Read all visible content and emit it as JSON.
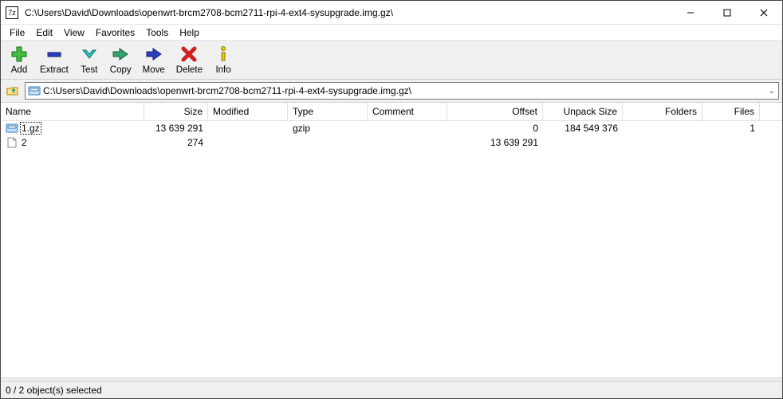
{
  "window": {
    "title": "C:\\Users\\David\\Downloads\\openwrt-brcm2708-bcm2711-rpi-4-ext4-sysupgrade.img.gz\\",
    "app_icon_label": "7z"
  },
  "menu": {
    "items": [
      "File",
      "Edit",
      "View",
      "Favorites",
      "Tools",
      "Help"
    ]
  },
  "toolbar": {
    "buttons": [
      {
        "id": "add",
        "label": "Add"
      },
      {
        "id": "extract",
        "label": "Extract"
      },
      {
        "id": "test",
        "label": "Test"
      },
      {
        "id": "copy",
        "label": "Copy"
      },
      {
        "id": "move",
        "label": "Move"
      },
      {
        "id": "delete",
        "label": "Delete"
      },
      {
        "id": "info",
        "label": "Info"
      }
    ]
  },
  "address": {
    "path": "C:\\Users\\David\\Downloads\\openwrt-brcm2708-bcm2711-rpi-4-ext4-sysupgrade.img.gz\\"
  },
  "columns": {
    "name": "Name",
    "size": "Size",
    "modified": "Modified",
    "type": "Type",
    "comment": "Comment",
    "offset": "Offset",
    "unpack": "Unpack Size",
    "folders": "Folders",
    "files": "Files"
  },
  "rows": [
    {
      "icon": "archive",
      "name": "1.gz",
      "size": "13 639 291",
      "modified": "",
      "type": "gzip",
      "comment": "",
      "offset": "0",
      "unpack": "184 549 376",
      "folders": "",
      "files": "1",
      "focused": true
    },
    {
      "icon": "file",
      "name": "2",
      "size": "274",
      "modified": "",
      "type": "",
      "comment": "",
      "offset": "13 639 291",
      "unpack": "",
      "folders": "",
      "files": "",
      "focused": false
    }
  ],
  "status": {
    "text": "0 / 2 object(s) selected"
  }
}
